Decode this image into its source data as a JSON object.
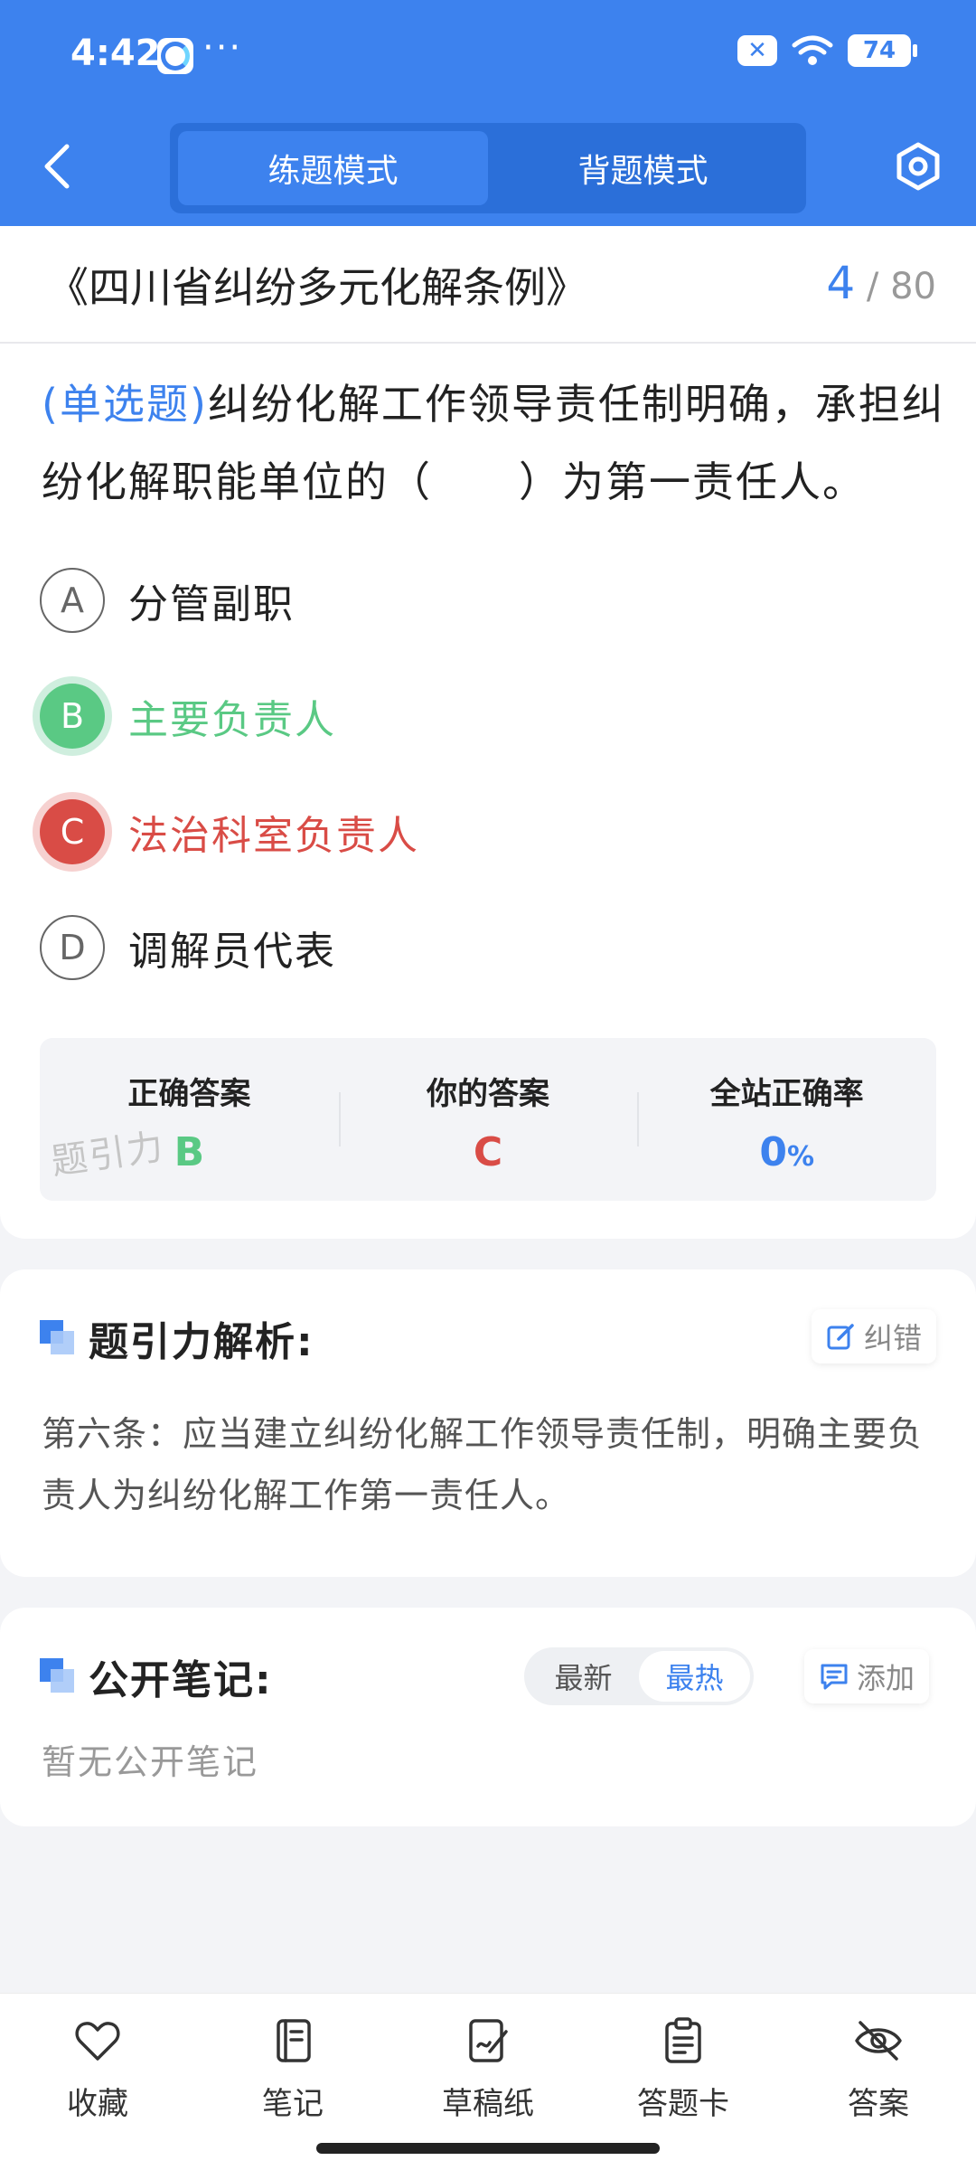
{
  "status_bar": {
    "time": "4:42",
    "more": "···",
    "battery": "74",
    "x_badge": "✕"
  },
  "header": {
    "modes": [
      "练题模式",
      "背题模式"
    ],
    "active_mode": 0
  },
  "paper": {
    "title": "《四川省纠纷多元化解条例》",
    "current": "4",
    "total": "/ 80"
  },
  "question": {
    "type": "(单选题)",
    "text": "纠纷化解工作领导责任制明确，承担纠纷化解职能单位的（　　）为第一责任人。",
    "options": [
      {
        "letter": "A",
        "text": "分管副职",
        "state": "normal"
      },
      {
        "letter": "B",
        "text": "主要负责人",
        "state": "correct"
      },
      {
        "letter": "C",
        "text": "法治科室负责人",
        "state": "wrong"
      },
      {
        "letter": "D",
        "text": "调解员代表",
        "state": "normal"
      }
    ]
  },
  "result": {
    "correct_label": "正确答案",
    "correct_value": "B",
    "yours_label": "你的答案",
    "yours_value": "C",
    "rate_label": "全站正确率",
    "rate_value": "0",
    "rate_unit": "%",
    "watermark": "题引力"
  },
  "analysis": {
    "title": "题引力解析:",
    "correct_btn": "纠错",
    "text": "第六条：应当建立纠纷化解工作领导责任制，明确主要负责人为纠纷化解工作第一责任人。"
  },
  "notes": {
    "title": "公开笔记:",
    "sort_options": [
      "最新",
      "最热"
    ],
    "active_sort": 1,
    "add_btn": "添加",
    "empty": "暂无公开笔记"
  },
  "bottom_nav": [
    {
      "label": "收藏",
      "icon": "heart-icon"
    },
    {
      "label": "笔记",
      "icon": "notebook-icon"
    },
    {
      "label": "草稿纸",
      "icon": "draft-icon"
    },
    {
      "label": "答题卡",
      "icon": "answer-sheet-icon"
    },
    {
      "label": "答案",
      "icon": "eye-off-icon"
    }
  ],
  "colors": {
    "primary": "#3d82ee",
    "correct": "#5ac984",
    "wrong": "#d94c46"
  }
}
